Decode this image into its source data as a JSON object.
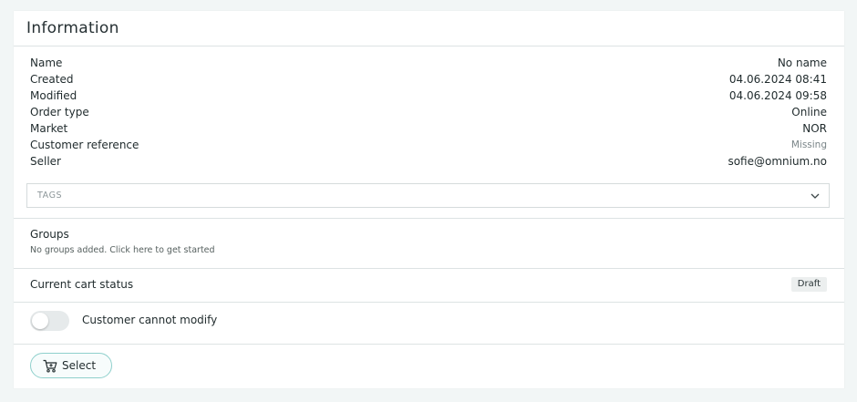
{
  "panel": {
    "title": "Information"
  },
  "info": {
    "rows": [
      {
        "label": "Name",
        "value": "No name"
      },
      {
        "label": "Created",
        "value": "04.06.2024 08:41"
      },
      {
        "label": "Modified",
        "value": "04.06.2024 09:58"
      },
      {
        "label": "Order type",
        "value": "Online"
      },
      {
        "label": "Market",
        "value": "NOR"
      },
      {
        "label": "Customer reference",
        "value": "Missing"
      },
      {
        "label": "Seller",
        "value": "sofie@omnium.no"
      }
    ]
  },
  "tags": {
    "placeholder": "TAGS",
    "icon": "chevron-down-icon"
  },
  "groups": {
    "title": "Groups",
    "empty_text": "No groups added. Click here to get started"
  },
  "cart_status": {
    "label": "Current cart status",
    "value": "Draft"
  },
  "toggle": {
    "label": "Customer cannot modify",
    "checked": false
  },
  "select_button": {
    "label": "Select",
    "icon": "cart-icon",
    "border_color": "#8fd0cc"
  }
}
